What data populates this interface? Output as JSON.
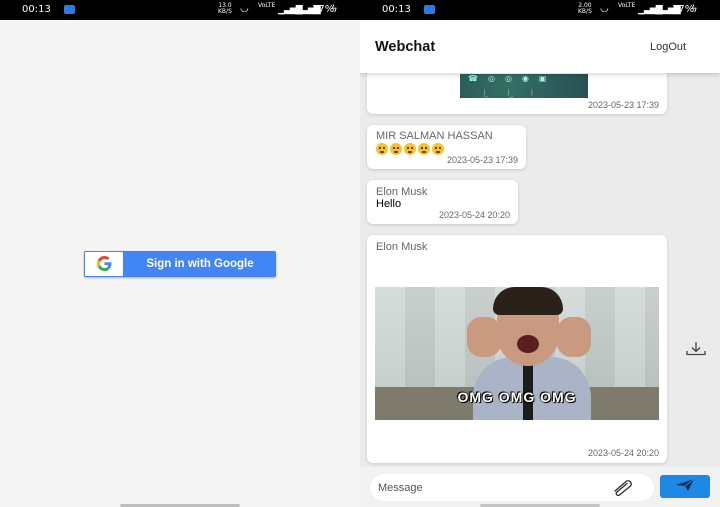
{
  "left_screen": {
    "status_bar": {
      "time": "00:13",
      "network_speed": "13.0",
      "network_unit": "KB/S",
      "carrier_tag": "VoLTE",
      "battery": "17%"
    },
    "google_signin": {
      "label": "Sign in with Google",
      "icon": "google-g-icon"
    }
  },
  "right_screen": {
    "status_bar": {
      "time": "00:13",
      "network_speed": "2.00",
      "network_unit": "KB/S",
      "carrier_tag": "VoLTE",
      "battery": "17%"
    },
    "appbar": {
      "title": "Webchat",
      "logout_label": "LogOut"
    },
    "messages": [
      {
        "type": "image",
        "sender": "",
        "timestamp": "2023-05-23 17:39"
      },
      {
        "type": "emoji",
        "sender": "MIR SALMAN HASSAN",
        "emoji_count": 5,
        "timestamp": "2023-05-23 17:39"
      },
      {
        "type": "text",
        "sender": "Elon Musk",
        "text": "Hello",
        "timestamp": "2023-05-24 20:20"
      },
      {
        "type": "gif",
        "sender": "Elon Musk",
        "gif_caption": "OMG OMG OMG",
        "timestamp": "2023-05-24 20:20"
      }
    ],
    "composer": {
      "placeholder": "Message",
      "attach_icon": "paperclip-icon",
      "send_icon": "send-icon"
    },
    "colors": {
      "accent": "#1e88e5",
      "google_blue": "#4285f4",
      "chat_background": "#ebebeb"
    }
  }
}
